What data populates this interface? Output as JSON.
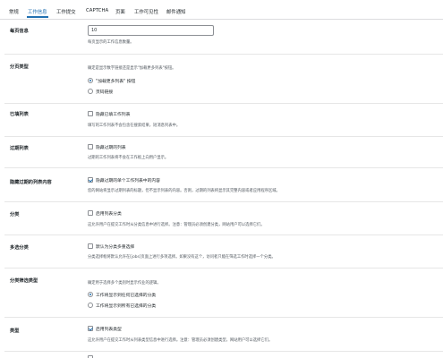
{
  "tabs": [
    "常规",
    "工作信息",
    "工作提交",
    "CAPTCHA",
    "页面",
    "工作可见性",
    "邮件通知"
  ],
  "active_tab": "工作信息",
  "per_page": {
    "label": "每页信息",
    "value": "10",
    "desc": "每页显示的工作信息数量。"
  },
  "pagination": {
    "label": "分页类型",
    "desc": "确定是显示数字链接还是显示\"加载更多列表\"按钮。",
    "options": [
      "\"加载更多列表\" 按钮",
      "页码链接"
    ],
    "selected": 0
  },
  "filled": {
    "label": "已填列表",
    "checkbox_label": "隐藏已填工作列表",
    "desc": "填写的工作列表不会包含在搜索结果，短消息列表中。",
    "checked": false
  },
  "expired": {
    "label": "过期列表",
    "checkbox_label": "隐藏过期的列表",
    "desc": "过期的工作列表将不会在工作板上向用户显示。",
    "checked": false
  },
  "expired_content": {
    "label": "隐藏过期的列表内容",
    "checkbox_label": "隐藏过期的单个工作列表中的内容",
    "desc": "您的网站将显示过期列表的标题，但不显示列表的内容。否则，过期的列表将显示其完整内容或者应用程序区域。",
    "checked": true
  },
  "categories": {
    "label": "分类",
    "checkbox_label": "启用列表分类",
    "desc": "这允许用户在提交工作时从分类信息中进行选择。注意：管理员必须创建分类，网站用户可以选择它们。",
    "checked": false
  },
  "multi_category": {
    "label": "多选分类",
    "checkbox_label": "默认为分类多重选择",
    "desc": "分类选择框将默认允许在[jobs]页面上进行多项选择。如果没有这个，访问者只能在筛选工作时选择一个分类。",
    "checked": false
  },
  "category_filter": {
    "label": "分类筛选类型",
    "desc": "确定用于选择多个类别时显示作业的逻辑。",
    "options": [
      "工作将显示到任何已选择的分类",
      "工作将显示到所有已选择的分类"
    ],
    "selected": 0
  },
  "types": {
    "label": "类型",
    "checkbox_label": "启用列表类型",
    "desc": "这允许用户在提交工作时从列表类型信息中进行选择。注意：管理员必须创建类型，网站用户可以选择它们。",
    "checked": true
  }
}
